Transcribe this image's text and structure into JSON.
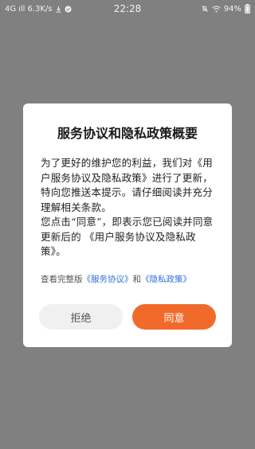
{
  "status_bar": {
    "network": "4G",
    "signal": "ıll",
    "speed": "6.3K/s",
    "time": "22:28",
    "battery": "94%",
    "icons": [
      "download-icon",
      "notification-icon",
      "mute-icon",
      "wifi-icon",
      "battery-icon"
    ]
  },
  "dialog": {
    "title": "服务协议和隐私政策概要",
    "paragraph1": "为了更好的维护您的利益，我们对《用户服务协议及隐私政策》进行了更新，特向您推送本提示。请仔细阅读并充分理解相关条款。",
    "paragraph2": "您点击“同意”，即表示您已阅读并同意更新后的 《用户服务协议及隐私政策》。",
    "links": {
      "prefix": "查看完整版",
      "service_link": "《服务协议》",
      "and": "和",
      "privacy_link": "《隐私政策》"
    },
    "reject_label": "拒绝",
    "accept_label": "同意"
  },
  "colors": {
    "overlay": "#808080",
    "accent": "#f26a2a",
    "link": "#2f6fd6"
  }
}
